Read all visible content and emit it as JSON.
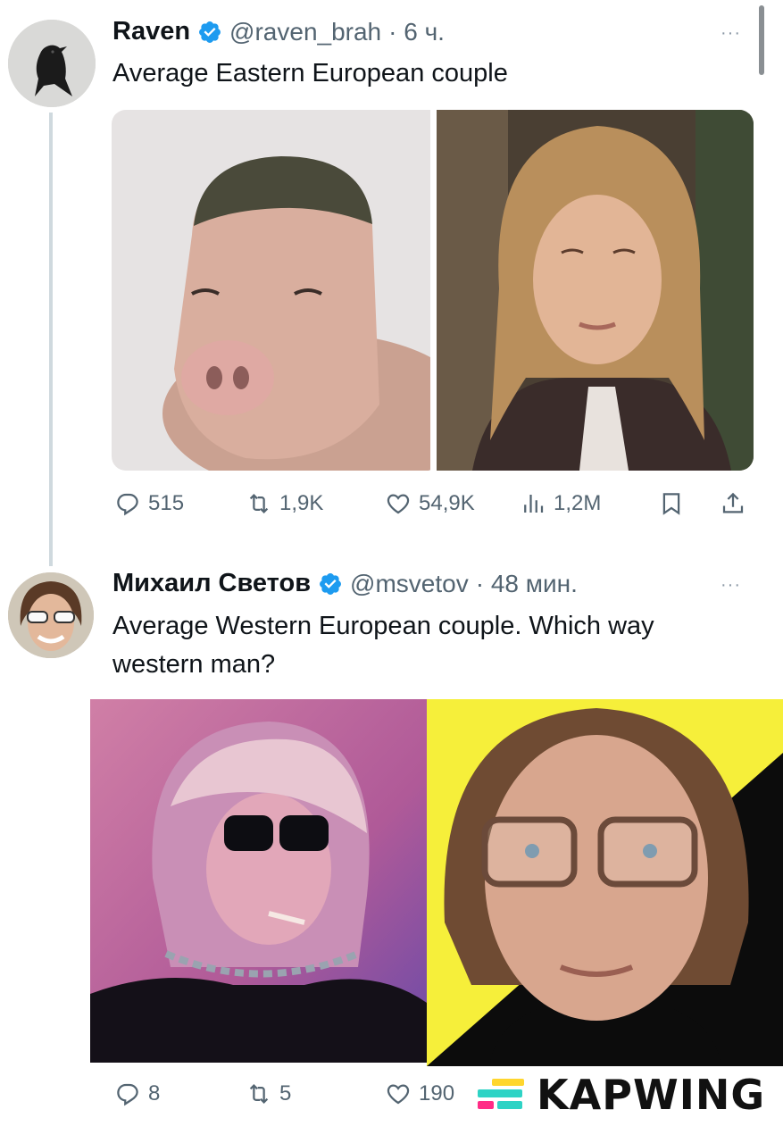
{
  "tweet1": {
    "name": "Raven",
    "handle": "@raven_brah",
    "time": "· 6 ч.",
    "text": "Average Eastern European couple",
    "more": "···",
    "stats": {
      "replies": "515",
      "retweets": "1,9K",
      "likes": "54,9K",
      "views": "1,2M"
    },
    "images": [
      "pig-with-haircut-photo",
      "woman-portrait-photo"
    ]
  },
  "tweet2": {
    "name": "Михаил Светов",
    "handle": "@msvetov",
    "time": "· 48 мин.",
    "text": "Average Western European couple. Which way western man?",
    "more": "···",
    "stats": {
      "replies": "8",
      "retweets": "5",
      "likes": "190"
    },
    "images": [
      "person-with-sunglasses-photo",
      "man-with-glasses-photo"
    ]
  },
  "watermark": {
    "text": "KAPWING"
  },
  "colors": {
    "verified": "#1d9bf0",
    "muted": "#536471",
    "thread_line": "#cfd9de",
    "kapwing_pink": "#ff2d86",
    "kapwing_teal": "#2ed3c5",
    "kapwing_yellow": "#ffd62e"
  },
  "icons": [
    "reply-icon",
    "retweet-icon",
    "like-icon",
    "views-icon",
    "bookmark-icon",
    "share-icon",
    "verified-badge-icon"
  ]
}
